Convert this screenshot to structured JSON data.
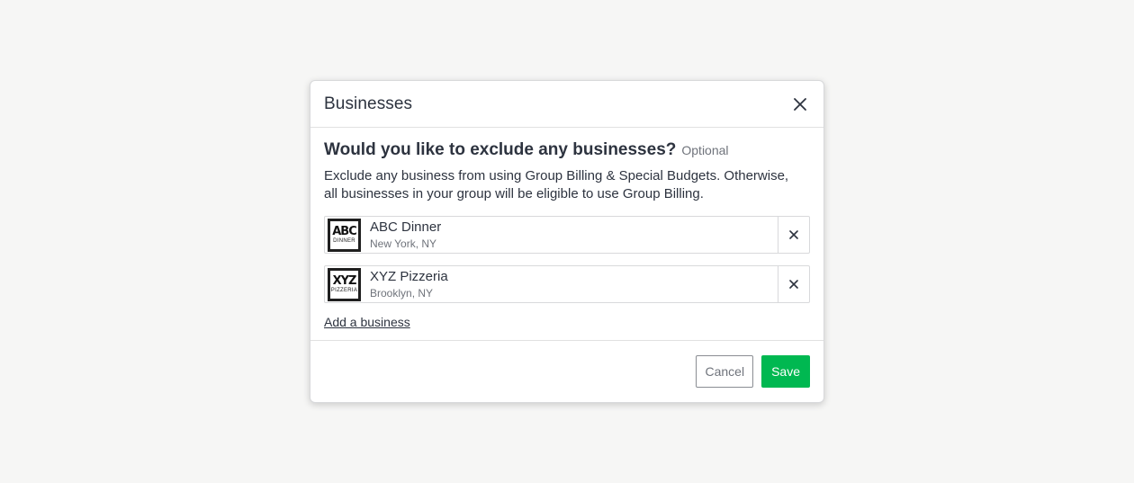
{
  "modal": {
    "title": "Businesses",
    "close_icon": "close-icon"
  },
  "question": {
    "text": "Would you like to exclude any businesses?",
    "optional": "Optional"
  },
  "description": "Exclude any business from using Group Billing & Special Budgets. Otherwise, all businesses in your group will be eligible to use Group Billing.",
  "businesses": [
    {
      "logo_main": "ABC",
      "logo_sub": "DINNER",
      "name": "ABC Dinner",
      "location": "New York, NY",
      "remove_icon": "close-icon"
    },
    {
      "logo_main": "XYZ",
      "logo_sub": "PIZZERIA",
      "name": "XYZ Pizzeria",
      "location": "Brooklyn, NY",
      "remove_icon": "close-icon"
    }
  ],
  "add_business": "Add a business",
  "footer": {
    "cancel_label": "Cancel",
    "save_label": "Save"
  },
  "colors": {
    "accent": "#00b851",
    "background": "#f6f6f5",
    "text": "#2d333f",
    "muted": "#6f737b"
  }
}
